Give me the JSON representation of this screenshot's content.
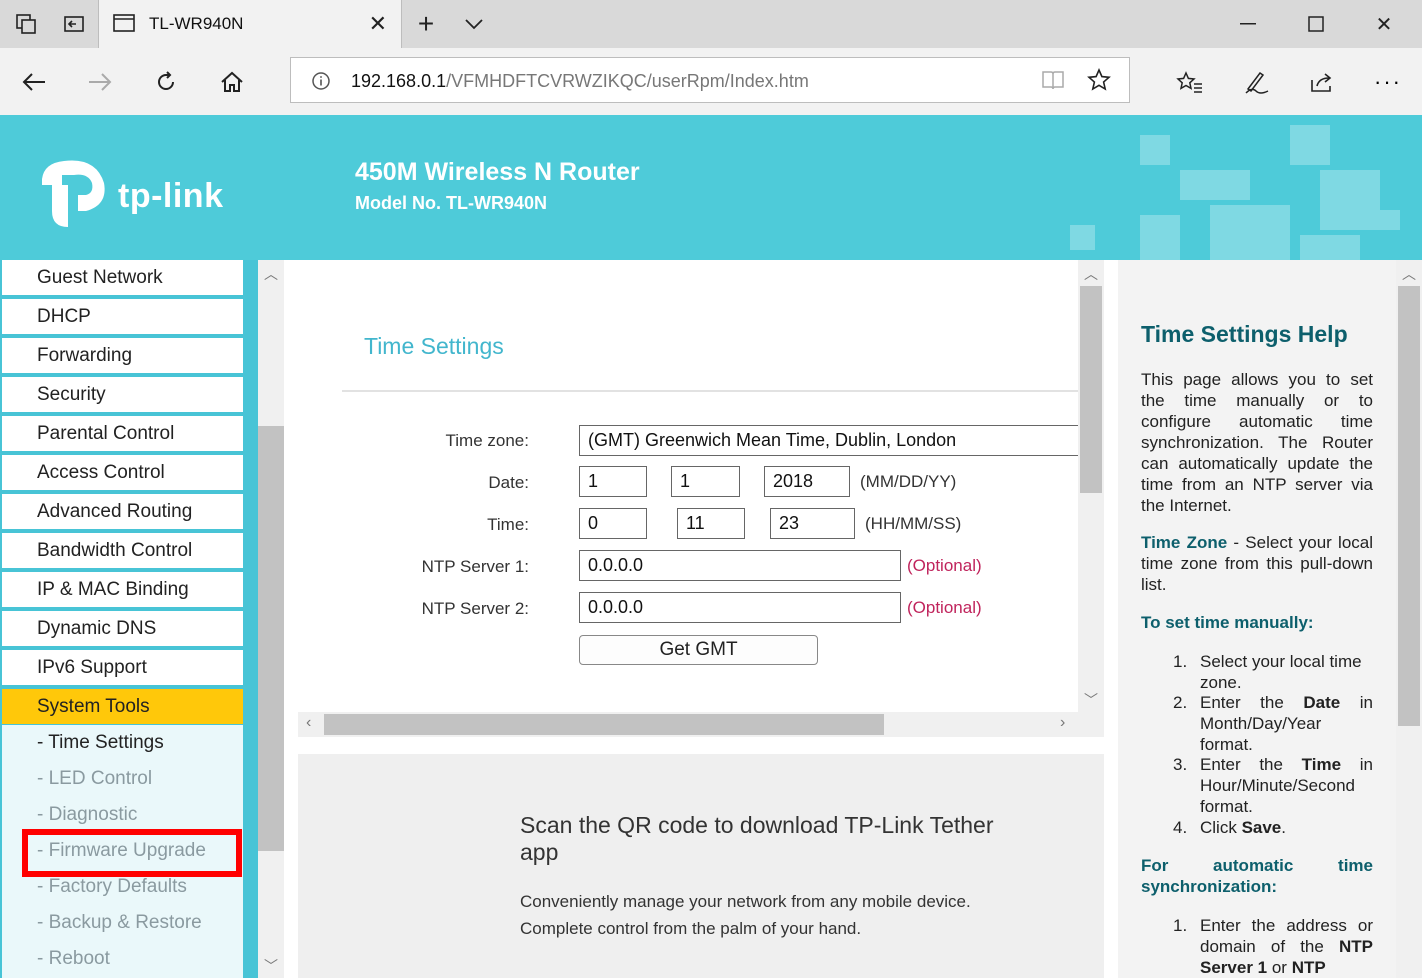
{
  "browser": {
    "tab_title": "TL-WR940N",
    "url_host": "192.168.0.1",
    "url_path": "/VFMHDFTCVRWZIKQC/userRpm/Index.htm"
  },
  "router": {
    "logo_text": "tp-link",
    "product_name": "450M Wireless N Router",
    "model": "Model No. TL-WR940N"
  },
  "menu": {
    "items": [
      "Guest Network",
      "DHCP",
      "Forwarding",
      "Security",
      "Parental Control",
      "Access Control",
      "Advanced Routing",
      "Bandwidth Control",
      "IP & MAC Binding",
      "Dynamic DNS",
      "IPv6 Support",
      "System Tools"
    ],
    "submenu": [
      "- Time Settings",
      "- LED Control",
      "- Diagnostic",
      "- Firmware Upgrade",
      "- Factory Defaults",
      "- Backup & Restore",
      "- Reboot"
    ]
  },
  "main": {
    "title": "Time Settings",
    "timezone_label": "Time zone:",
    "timezone_value": "(GMT) Greenwich Mean Time, Dublin, London",
    "date_label": "Date:",
    "date_month": "1",
    "date_day": "1",
    "date_year": "2018",
    "date_hint": "(MM/DD/YY)",
    "time_label": "Time:",
    "time_hour": "0",
    "time_min": "11",
    "time_sec": "23",
    "time_hint": "(HH/MM/SS)",
    "ntp1_label": "NTP Server 1:",
    "ntp1_value": "0.0.0.0",
    "ntp2_label": "NTP Server 2:",
    "ntp2_value": "0.0.0.0",
    "optional": "(Optional)",
    "get_gmt": "Get GMT"
  },
  "qr": {
    "title": "Scan the QR code to download TP-Link Tether app",
    "desc1": "Conveniently manage your network from any mobile device.",
    "desc2": "Complete control from the palm of your hand."
  },
  "help": {
    "title": "Time Settings Help",
    "intro": "This page allows you to set the time manually or to configure automatic time synchronization. The Router can automatically update the time from an NTP server via the Internet.",
    "tz_term": "Time Zone",
    "tz_text": " - Select your local time zone from this pull-down list.",
    "manual_heading": "To set time manually:",
    "manual_1": "Select your local time zone.",
    "manual_2a": "Enter the ",
    "manual_2b": "Date",
    "manual_2c": " in Month/Day/Year format.",
    "manual_3a": "Enter the ",
    "manual_3b": "Time",
    "manual_3c": " in Hour/Minute/Second format.",
    "manual_4a": "Click ",
    "manual_4b": "Save",
    "manual_4c": ".",
    "auto_heading": "For automatic time synchronization:",
    "auto_1a": "Enter the address or domain of the ",
    "auto_1b": "NTP Server 1",
    "auto_1c": " or ",
    "auto_1d": "NTP",
    "num_1": "1.",
    "num_2": "2.",
    "num_3": "3.",
    "num_4": "4."
  },
  "colors": {
    "header_bg": "#4ecbd9",
    "menu_active": "#ffc80a",
    "accent_title": "#42b6cd",
    "help_heading": "#0d5f6c",
    "optional": "#c0245c",
    "highlight": "#ff0000"
  }
}
